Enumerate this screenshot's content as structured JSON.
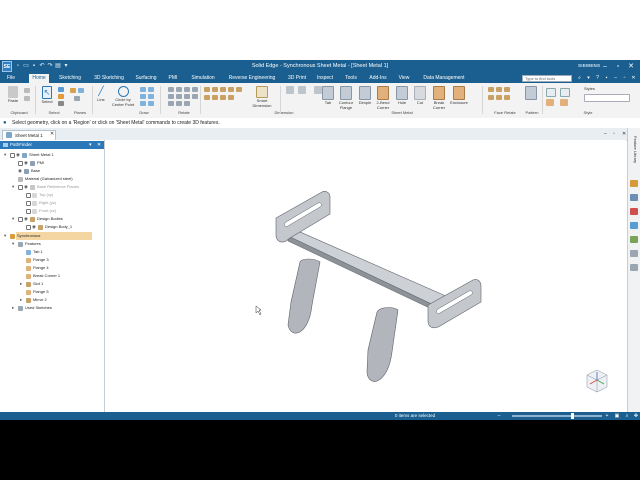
{
  "app": {
    "logo": "SE",
    "title": "Solid Edge - Synchronous Sheet Metal - [Sheet Metal 1]",
    "brand": "SIEMENS",
    "qat_icons": [
      "new-icon",
      "open-icon",
      "save-icon",
      "undo-icon",
      "redo-icon",
      "print-icon",
      "dropdown-icon"
    ]
  },
  "menu": {
    "tabs": [
      "File",
      "Home",
      "Sketching",
      "3D Sketching",
      "Surfacing",
      "PMI",
      "Simulation",
      "Reverse Engineering",
      "3D Print",
      "Inspect",
      "Tools",
      "Add-Ins",
      "View",
      "Data Management"
    ],
    "active": "Home",
    "find_placeholder": "Type to find tools"
  },
  "ribbon": {
    "buttons": {
      "paste": "Paste",
      "select": "Select",
      "line": "Line",
      "circle": "Circle by Center Point",
      "smart_dimension": "Smart Dimension",
      "tab": "Tab",
      "contour_flange": "Contour Flange",
      "dimple": "Dimple",
      "two_bend_corner": "2-Bend Corner",
      "hole": "Hole",
      "cut": "Cut",
      "break_corner": "Break Corner",
      "enclosure": "Enclosure"
    },
    "groups": [
      "Clipboard",
      "Select",
      "Planes",
      "Draw",
      "Relate",
      "Dimension",
      "Sheet Metal",
      "Face Relate",
      "Pattern",
      "Style"
    ],
    "styles_label": "Styles"
  },
  "prompt": {
    "text": "Select geometry, click on a 'Region' or click on 'Sheet Metal' commands to create 3D features."
  },
  "doc": {
    "tab_label": "Sheet Metal 1"
  },
  "pathfinder": {
    "title": "PathFinder",
    "items": [
      {
        "label": "Sheet Metal 1",
        "dim": false
      },
      {
        "label": "PMI",
        "dim": false
      },
      {
        "label": "Base",
        "dim": false
      },
      {
        "label": "Material (Galvanized steel)",
        "dim": false
      },
      {
        "label": "Base Reference Planes",
        "dim": true
      },
      {
        "label": "Top (xy)",
        "dim": true
      },
      {
        "label": "Right (yz)",
        "dim": true
      },
      {
        "label": "Front (xz)",
        "dim": true
      },
      {
        "label": "Design Bodies",
        "dim": false
      },
      {
        "label": "Design Body_1",
        "dim": false
      },
      {
        "label": "Synchronous",
        "dim": false
      },
      {
        "label": "Features",
        "dim": false
      },
      {
        "label": "Tab 1",
        "dim": false
      },
      {
        "label": "Flange 3",
        "dim": false
      },
      {
        "label": "Flange 4",
        "dim": false
      },
      {
        "label": "Break Corner 1",
        "dim": false
      },
      {
        "label": "Slot 1",
        "dim": false
      },
      {
        "label": "Flange 5",
        "dim": false
      },
      {
        "label": "Mirror 2",
        "dim": false
      },
      {
        "label": "Used Sketches",
        "dim": false
      }
    ]
  },
  "right_sidebar": {
    "feature_library": "Feature Library"
  },
  "status": {
    "text": "0 items are selected"
  },
  "colors": {
    "title_bar": "#1a5f8f",
    "accent": "#2b78b8",
    "highlight": "#f4d6a3",
    "part_metal": "#a9adb3"
  }
}
